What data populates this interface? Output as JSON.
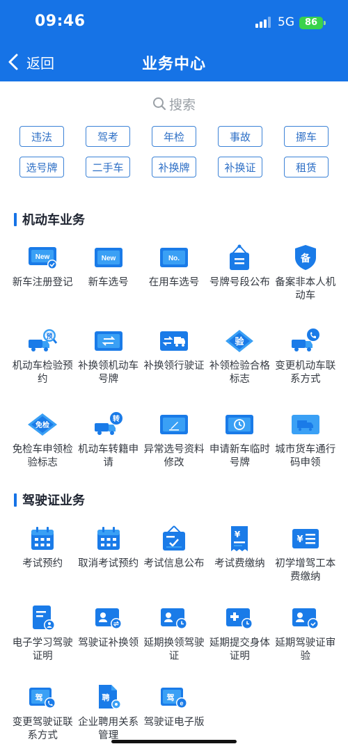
{
  "status": {
    "time": "09:46",
    "network": "5G",
    "battery": "86"
  },
  "nav": {
    "back_label": "返回",
    "title": "业务中心"
  },
  "search": {
    "placeholder": "搜索"
  },
  "quick_tags": [
    [
      "违法",
      "驾考",
      "年检",
      "事故",
      "挪车"
    ],
    [
      "选号牌",
      "二手车",
      "补换牌",
      "补换证",
      "租赁"
    ]
  ],
  "sections": [
    {
      "title": "机动车业务",
      "items": [
        {
          "label": "新车注册登记",
          "icon": "new-plate-check-icon"
        },
        {
          "label": "新车选号",
          "icon": "new-plate-icon"
        },
        {
          "label": "在用车选号",
          "icon": "number-plate-icon"
        },
        {
          "label": "号牌号段公布",
          "icon": "hanging-sign-icon"
        },
        {
          "label": "备案非本人机动车",
          "icon": "filing-shield-icon"
        },
        {
          "label": "机动车检验预约",
          "icon": "truck-inspection-icon"
        },
        {
          "label": "补换领机动车号牌",
          "icon": "plate-exchange-icon"
        },
        {
          "label": "补换领行驶证",
          "icon": "license-truck-icon"
        },
        {
          "label": "补领检验合格标志",
          "icon": "inspection-badge-icon"
        },
        {
          "label": "变更机动车联系方式",
          "icon": "truck-phone-icon"
        },
        {
          "label": "免检车申领检验标志",
          "icon": "exempt-badge-icon"
        },
        {
          "label": "机动车转籍申请",
          "icon": "truck-transfer-icon"
        },
        {
          "label": "异常选号资料修改",
          "icon": "edit-plate-icon"
        },
        {
          "label": "申请新车临时号牌",
          "icon": "temporary-plate-icon"
        },
        {
          "label": "城市货车通行码申领",
          "icon": "cargo-truck-icon"
        }
      ]
    },
    {
      "title": "驾驶证业务",
      "items": [
        {
          "label": "考试预约",
          "icon": "calendar-icon"
        },
        {
          "label": "取消考试预约",
          "icon": "calendar-cancel-icon"
        },
        {
          "label": "考试信息公布",
          "icon": "notice-board-icon"
        },
        {
          "label": "考试费缴纳",
          "icon": "yen-receipt-icon"
        },
        {
          "label": "初学增驾工本费缴纳",
          "icon": "yen-card-icon"
        },
        {
          "label": "电子学习驾驶证明",
          "icon": "document-user-icon"
        },
        {
          "label": "驾驶证补换领",
          "icon": "id-card-exchange-icon"
        },
        {
          "label": "延期换领驾驶证",
          "icon": "id-card-clock-icon"
        },
        {
          "label": "延期提交身体证明",
          "icon": "medical-clock-icon"
        },
        {
          "label": "延期驾驶证审验",
          "icon": "id-card-check-icon"
        },
        {
          "label": "变更驾驶证联系方式",
          "icon": "license-phone-icon"
        },
        {
          "label": "企业聘用关系管理",
          "icon": "hire-document-icon"
        },
        {
          "label": "驾驶证电子版",
          "icon": "e-license-icon"
        }
      ]
    }
  ],
  "icon_text": {
    "new": "New",
    "no": "No.",
    "bei": "备",
    "yu": "预",
    "yan": "验",
    "mianjian": "免检",
    "zhuan": "转",
    "yen": "¥",
    "jia": "驾",
    "pin": "聘",
    "e": "e"
  },
  "colors": {
    "brand": "#1673e6",
    "icon_light": "#3aa0f5",
    "icon_dark": "#1a7be8",
    "text": "#333840"
  }
}
